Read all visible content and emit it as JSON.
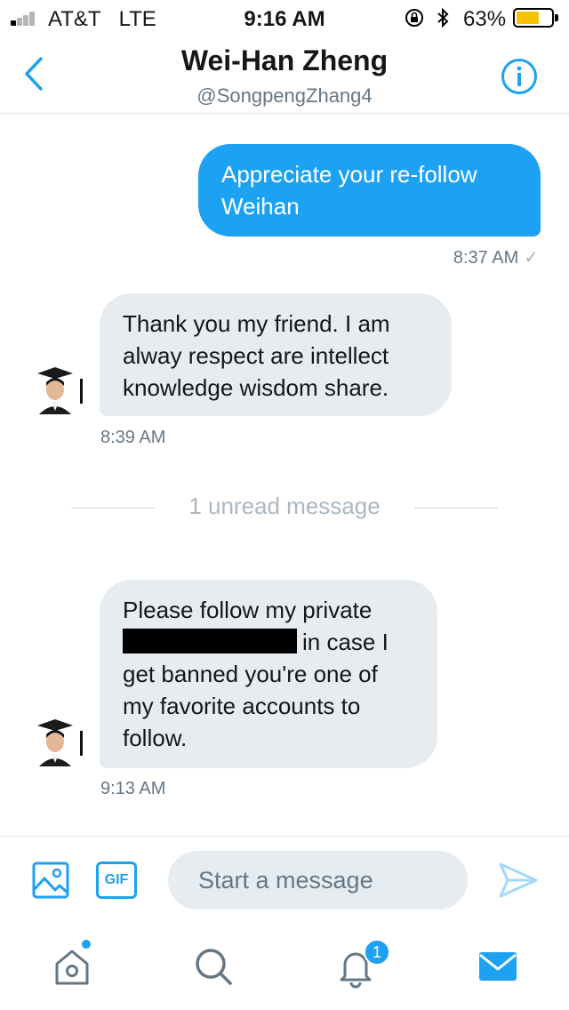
{
  "status_bar": {
    "carrier": "AT&T",
    "network": "LTE",
    "time": "9:16 AM",
    "battery_percent": "63%",
    "battery_level": 0.63,
    "signal_bars_filled": 1,
    "icons": [
      "signal-icon",
      "rotation-lock-icon",
      "bluetooth-icon",
      "battery-icon"
    ]
  },
  "header": {
    "title": "Wei-Han Zheng",
    "handle": "@SongpengZhang4",
    "back_icon": "chevron-left-icon",
    "info_icon": "info-icon"
  },
  "messages": [
    {
      "direction": "outgoing",
      "text": "Appreciate your re-follow Weihan",
      "time": "8:37 AM",
      "status_icon": "checkmark-icon"
    },
    {
      "direction": "incoming",
      "text": "Thank you my friend.  I am alway respect are intellect knowledge wisdom share.",
      "time": "8:39 AM"
    },
    {
      "direction": "incoming",
      "text_before_redaction": "Please follow my private",
      "text_after_redaction": "in case I get banned you're one of my favorite accounts to follow.",
      "time": "9:13 AM"
    }
  ],
  "unread_divider": "1 unread message",
  "compose": {
    "placeholder": "Start a message",
    "gif_label": "GIF",
    "icons": [
      "image-icon",
      "gif-icon",
      "send-icon"
    ]
  },
  "tabbar": {
    "notifications_badge": "1",
    "icons": [
      "home-icon",
      "search-icon",
      "bell-icon",
      "mail-icon"
    ]
  },
  "colors": {
    "accent": "#1da1f2",
    "bubble_incoming": "#e6ecf0",
    "secondary_text": "#657786",
    "battery": "#f5c300"
  }
}
